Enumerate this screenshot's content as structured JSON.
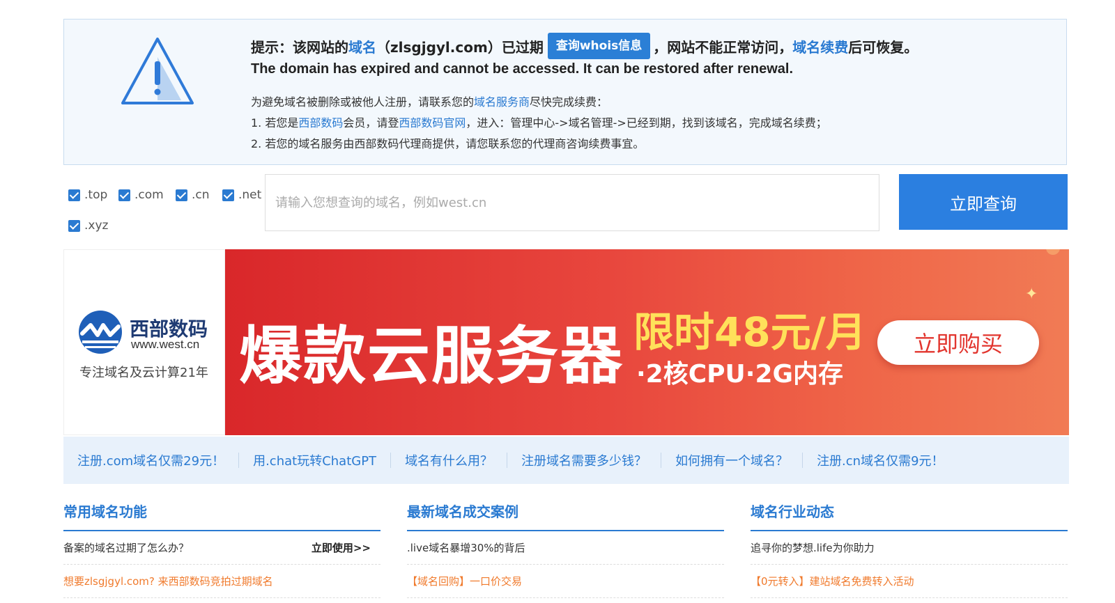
{
  "notice": {
    "title_prefix": "提示：该网站的",
    "title_domain_link": "域名",
    "title_domain": "（zlsgjgyl.com）已过期",
    "whois_button": "查询whois信息",
    "title_middle": "，网站不能正常访问，",
    "title_renew_link": "域名续费",
    "title_suffix": "后可恢复。",
    "english": "The domain has expired and cannot be accessed. It can be restored after renewal.",
    "line1_prefix": "为避免域名被删除或被他人注册，请联系您的",
    "line1_link": "域名服务商",
    "line1_suffix": "尽快完成续费：",
    "line2_prefix": "1. 若您是",
    "line2_link1": "西部数码",
    "line2_mid": "会员，请登",
    "line2_link2": "西部数码官网",
    "line2_suffix": "，进入：管理中心->域名管理->已经到期，找到该域名，完成域名续费；",
    "line3": "2. 若您的域名服务由西部数码代理商提供，请您联系您的代理商咨询续费事宜。"
  },
  "search": {
    "extensions": [
      ".top",
      ".com",
      ".cn",
      ".net",
      ".xyz"
    ],
    "placeholder": "请输入您想查询的域名，例如west.cn",
    "button": "立即查询"
  },
  "banner": {
    "logo_name": "西部数码",
    "logo_url": "www.west.cn",
    "slogan": "专注域名及云计算21年",
    "headline": "爆款云服务器",
    "price": "限时48元/月",
    "spec": "·2核CPU·2G内存",
    "buy_button": "立即购买"
  },
  "quick_links": [
    "注册.com域名仅需29元！",
    "用.chat玩转ChatGPT",
    "域名有什么用？",
    "注册域名需要多少钱？",
    "如何拥有一个域名？",
    "注册.cn域名仅需9元！"
  ],
  "columns": [
    {
      "title": "常用域名功能",
      "row1": "备案的域名过期了怎么办？",
      "row1_action": "立即使用>>",
      "row2": "想要zlsgjgyl.com? 来西部数码竞拍过期域名"
    },
    {
      "title": "最新域名成交案例",
      "row1": ".live域名暴增30%的背后",
      "row1_action": "",
      "row2": "【域名回购】一口价交易"
    },
    {
      "title": "域名行业动态",
      "row1": "追寻你的梦想.life为你助力",
      "row1_action": "",
      "row2": "【0元转入】建站域名免费转入活动"
    }
  ],
  "colors": {
    "accent": "#2a7ad1",
    "orange": "#f07a2c",
    "banner_red": "#d9272a",
    "price_yellow": "#ffe15a"
  },
  "icons": [
    "warning-icon",
    "west-logo-icon",
    "checkbox-icon",
    "sparkle-icon"
  ]
}
